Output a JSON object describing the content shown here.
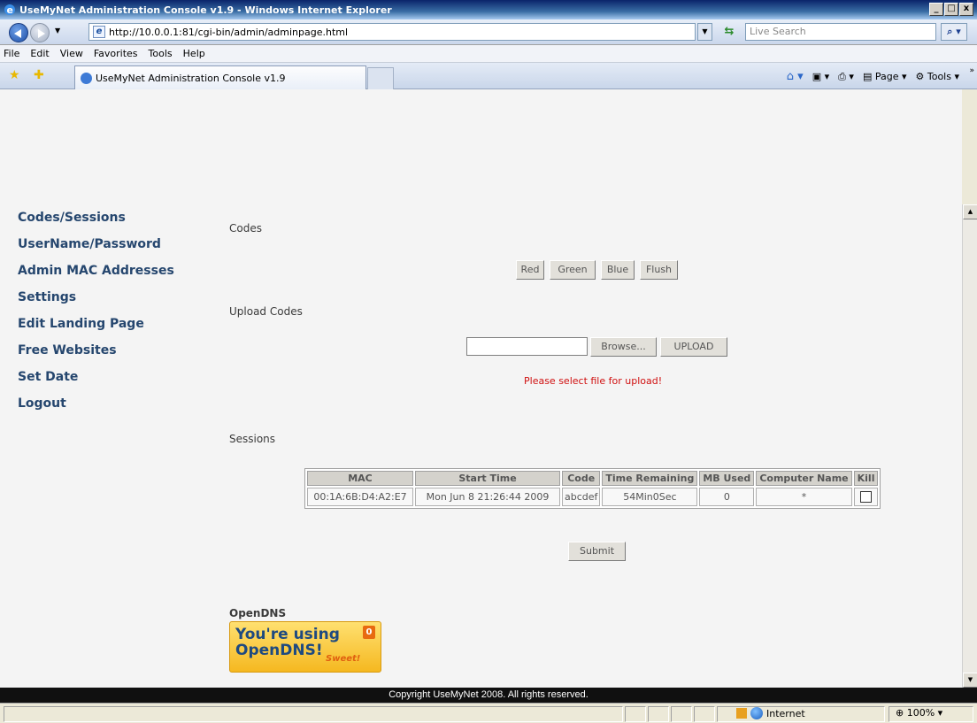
{
  "window": {
    "title": "UseMyNet Administration Console v1.9 - Windows Internet Explorer"
  },
  "address": {
    "url": "http://10.0.0.1:81/cgi-bin/admin/adminpage.html",
    "search_placeholder": "Live Search"
  },
  "menu": [
    "File",
    "Edit",
    "View",
    "Favorites",
    "Tools",
    "Help"
  ],
  "tab": {
    "title": "UseMyNet Administration Console v1.9"
  },
  "command_bar": {
    "page_label": "Page",
    "tools_label": "Tools"
  },
  "sidebar": {
    "items": [
      {
        "label": "Codes/Sessions"
      },
      {
        "label": "UserName/Password"
      },
      {
        "label": "Admin MAC Addresses"
      },
      {
        "label": "Settings"
      },
      {
        "label": "Edit Landing Page"
      },
      {
        "label": "Free Websites"
      },
      {
        "label": "Set Date"
      },
      {
        "label": "Logout"
      }
    ]
  },
  "codes": {
    "title": "Codes",
    "buttons": [
      "Red",
      "Green",
      "Blue",
      "Flush"
    ]
  },
  "upload": {
    "title": "Upload Codes",
    "browse_label": "Browse...",
    "upload_label": "UPLOAD",
    "message": "Please select file for upload!"
  },
  "sessions": {
    "title": "Sessions",
    "columns": [
      "MAC",
      "Start Time",
      "Code",
      "Time Remaining",
      "MB Used",
      "Computer Name",
      "Kill"
    ],
    "rows": [
      {
        "mac": "00:1A:6B:D4:A2:E7",
        "start_time": "Mon Jun 8 21:26:44 2009",
        "code": "abcdef",
        "time_remaining": "54Min0Sec",
        "mb_used": "0",
        "computer_name": "*",
        "kill": false
      }
    ],
    "submit_label": "Submit"
  },
  "opendns": {
    "title": "OpenDNS",
    "badge_line1": "You're using",
    "badge_line2": "OpenDNS!",
    "badge_sweet": "Sweet!",
    "badge_count": "0"
  },
  "footer": {
    "text": "Copyright UseMyNet 2008. All rights reserved."
  },
  "status": {
    "zone": "Internet",
    "zoom": "100%"
  }
}
